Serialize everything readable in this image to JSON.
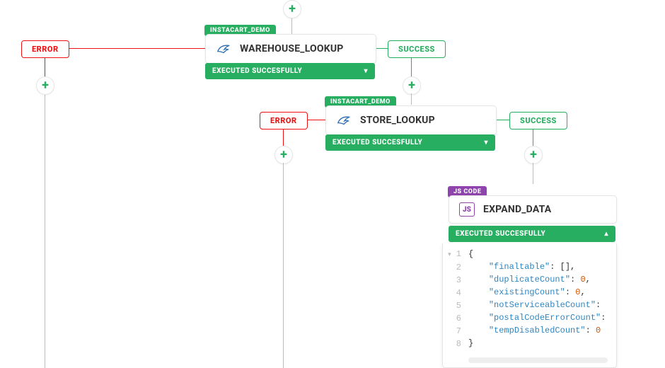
{
  "labels": {
    "plus": "+",
    "error": "ERROR",
    "success": "SUCCESS",
    "caret_down": "▾",
    "caret_up": "▴",
    "js": "JS"
  },
  "tags": {
    "instacart_demo": "INSTACART_DEMO",
    "js_code": "JS CODE"
  },
  "status": {
    "executed": "EXECUTED SUCCESFULLY"
  },
  "nodes": {
    "warehouse": "WAREHOUSE_LOOKUP",
    "store": "STORE_LOOKUP",
    "expand": "EXPAND_DATA"
  },
  "code": {
    "lines": [
      "1",
      "2",
      "3",
      "4",
      "5",
      "6",
      "7",
      "8"
    ],
    "content": {
      "l1_open": "{",
      "l2_key": "\"finaltable\"",
      "l2_rest": ": [],",
      "l3_key": "\"duplicateCount\"",
      "l3_num": "0",
      "l3_rest": ",",
      "l4_key": "\"existingCount\"",
      "l4_num": "0",
      "l4_rest": ",",
      "l5_key": "\"notServiceableCount\"",
      "l5_rest": ":",
      "l6_key": "\"postalCodeErrorCount\"",
      "l6_rest": ":",
      "l7_key": "\"tempDisabledCount\"",
      "l7_num": "0",
      "l8_close": "}"
    }
  }
}
